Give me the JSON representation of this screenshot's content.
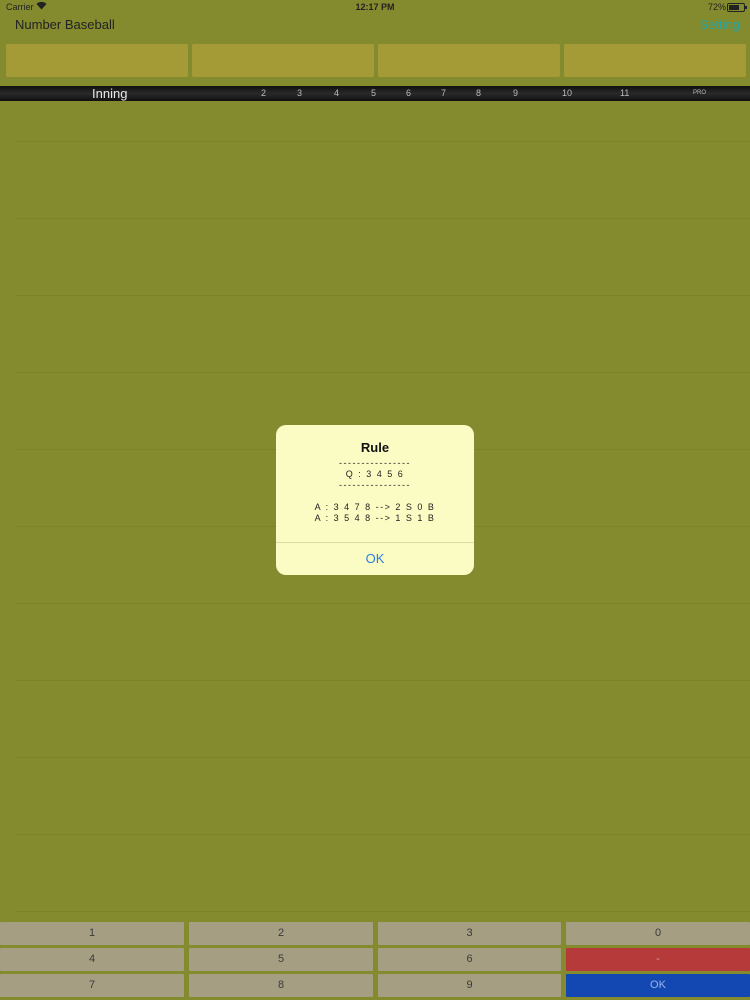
{
  "status_bar": {
    "carrier": "Carrier",
    "time": "12:17 PM",
    "battery": "72%",
    "battery_level": 0.72,
    "icons": [
      "wifi-icon",
      "battery-icon"
    ]
  },
  "nav": {
    "title": "Number Baseball",
    "setting_label": "Setting"
  },
  "inning_bar": {
    "label": "Inning",
    "numbers": [
      "2",
      "3",
      "4",
      "5",
      "6",
      "7",
      "8",
      "9",
      "10",
      "11"
    ],
    "extra": "PRO"
  },
  "keypad": {
    "keys": [
      "1",
      "2",
      "3",
      "0",
      "4",
      "5",
      "6",
      "-",
      "7",
      "8",
      "9",
      "OK"
    ]
  },
  "dialog": {
    "title": "Rule",
    "message": "----------------\nQ : 3 4 5 6\n----------------\n\nA : 3 4 7 8 --> 2 S 0 B\nA : 3 5 4 8 --> 1 S 1 B",
    "ok_label": "OK"
  },
  "colors": {
    "background": "#848a2e",
    "accent": "#28a7a0",
    "slot": "#a49b37",
    "dialog_bg": "#fbfbc4",
    "key": "#a69e83",
    "key_minus": "#b63a3a",
    "key_ok": "#1347b2"
  }
}
